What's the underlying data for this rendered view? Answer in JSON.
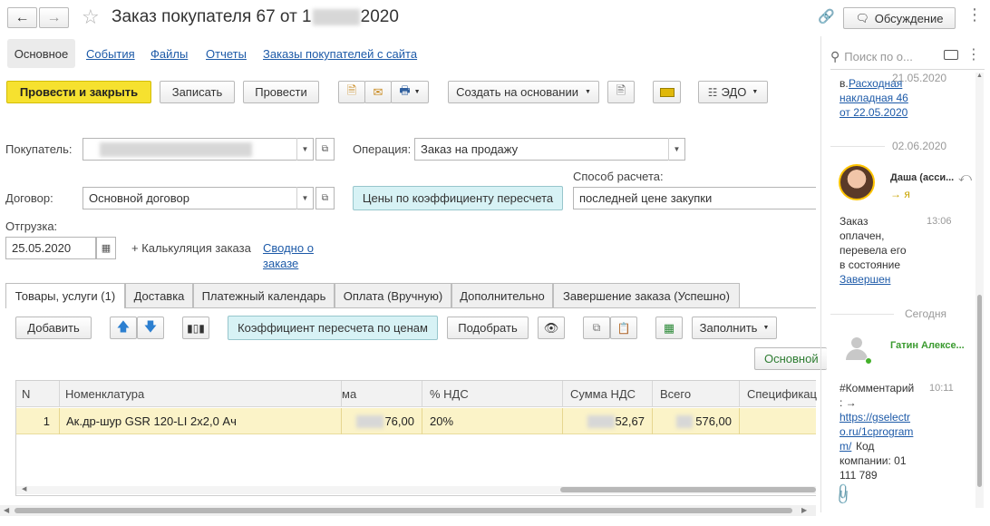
{
  "window": {
    "title": "Заказ покупателя 67 от 1",
    "title_year": "2020",
    "discuss_label": "Обсуждение"
  },
  "nav_tabs": [
    {
      "label": "Основное"
    },
    {
      "label": "События"
    },
    {
      "label": "Файлы"
    },
    {
      "label": "Отчеты"
    },
    {
      "label": "Заказы покупателей с сайта"
    }
  ],
  "toolbar": {
    "post_close": "Провести и закрыть",
    "save": "Записать",
    "post": "Провести",
    "create_based": "Создать на основании",
    "edo": "ЭДО"
  },
  "form": {
    "buyer_label": "Покупатель:",
    "operation_label": "Операция:",
    "operation_value": "Заказ на продажу",
    "pay_method_label": "Способ расчета:",
    "contract_label": "Договор:",
    "contract_value": "Основной договор",
    "price_coef_button": "Цены по коэффициенту пересчета",
    "pay_method_value": "последней цене закупки",
    "shipment_label": "Отгрузка:",
    "shipment_date": "25.05.2020",
    "calc_label": "+ Калькуляция заказа",
    "summary_link_line1": "Сводно о",
    "summary_link_line2": "заказе"
  },
  "doc_tabs": [
    {
      "label": "Товары, услуги (1)"
    },
    {
      "label": "Доставка"
    },
    {
      "label": "Платежный календарь"
    },
    {
      "label": "Оплата (Вручную)"
    },
    {
      "label": "Дополнительно"
    },
    {
      "label": "Завершение заказа (Успешно)"
    }
  ],
  "table_toolbar": {
    "add": "Добавить",
    "coef_button": "Коэффициент пересчета по ценам",
    "pick": "Подобрать",
    "fill": "Заполнить",
    "main_button": "Основной"
  },
  "table": {
    "headers": [
      "N",
      "Номенклатура",
      "ма",
      "% НДС",
      "Сумма НДС",
      "Всего",
      "Спецификац"
    ],
    "rows": [
      {
        "n": "1",
        "name": "Ак.др-шур GSR 120-LI 2x2,0 Ач",
        "sum": "76,00",
        "vat_pct": "20%",
        "vat_sum": "52,67",
        "total": "576,00"
      }
    ]
  },
  "sidebar": {
    "search_placeholder": "Поиск по о...",
    "msg1": {
      "date": "21.05.2020",
      "line0": "в.",
      "link1": "Расходная",
      "link2": "накладная 46",
      "link3": "от 22.05.2020"
    },
    "date_sep1": "02.06.2020",
    "msg2": {
      "author": "Даша (асси...",
      "to": "→ я",
      "text": [
        "Заказ",
        "оплачен,",
        "перевела его",
        "в состояние"
      ],
      "link": "Завершен",
      "time": "13:06"
    },
    "date_sep2": "Сегодня",
    "msg3": {
      "author": "Гатин Алексе...",
      "text1": "#Комментарий",
      "text2": ": →",
      "link": [
        "https://gselectr",
        "o.ru/1cprogram",
        "m/"
      ],
      "tail": [
        "Код",
        "компании: 01",
        "111 789"
      ],
      "time": "10:11"
    }
  },
  "colors": {
    "accent_yellow": "#f6e12f",
    "row_highlight": "#fbf3c8",
    "link_blue": "#1d5aa8",
    "cyan_button": "#d7f2f5",
    "author_green": "#3a9a2f"
  }
}
